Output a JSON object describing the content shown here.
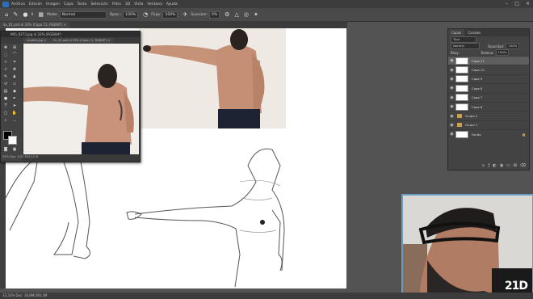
{
  "menu": {
    "items": [
      "Archivo",
      "Edición",
      "Imagen",
      "Capa",
      "Texto",
      "Selección",
      "Filtro",
      "3D",
      "Vista",
      "Ventana",
      "Ayuda"
    ]
  },
  "options": {
    "mode_label": "Modo:",
    "mode_value": "Normal",
    "opacity_label": "Opac.:",
    "opacity_value": "100%",
    "flow_label": "Flujo:",
    "flow_value": "100%",
    "smoothing_label": "Suavizar:",
    "smoothing_value": "0%",
    "brush_size": "9"
  },
  "doc_tabs": {
    "main_tab": "ilu_01.psd al 33% (Capa 11, RGB/8*) ×"
  },
  "reference_window": {
    "title": "IMG_9273.jpg al 33% (RGB/8#)",
    "tab1": "modelo.jpg ×",
    "tab2": "ilu_01.psd al 33% (Capa 11, RGB/8*) ×",
    "status": "33%     Doc: 3,22 M/3,22 M"
  },
  "layers_panel": {
    "tab_layers": "Capas",
    "tab_channels": "Canales",
    "kind_label": "Tipo",
    "blend_mode": "Normal",
    "opacity_label": "Opacidad:",
    "opacity_value": "100%",
    "lock_label": "Bloq.:",
    "fill_label": "Relleno:",
    "fill_value": "100%",
    "layers": [
      {
        "name": "Capa 11",
        "type": "layer",
        "selected": true
      },
      {
        "name": "Capa 10",
        "type": "layer",
        "selected": false
      },
      {
        "name": "Capa 9",
        "type": "layer",
        "selected": false
      },
      {
        "name": "Capa 8",
        "type": "layer",
        "selected": false
      },
      {
        "name": "Capa 7",
        "type": "layer",
        "selected": false
      },
      {
        "name": "Capa 6",
        "type": "layer",
        "selected": false
      },
      {
        "name": "Grupo 2",
        "type": "group",
        "selected": false
      },
      {
        "name": "Grupo 1",
        "type": "group",
        "selected": false
      },
      {
        "name": "Fondo",
        "type": "background",
        "selected": false
      }
    ]
  },
  "status_bar": {
    "text": "33,33%     Doc: 18,8M/280,3M"
  },
  "webcam": {
    "logo": "21D"
  },
  "icons": {
    "brush": "brush-icon",
    "eye": "eye-icon",
    "lock": "lock-icon",
    "folder": "folder-icon"
  },
  "colors": {
    "ui_dark": "#3c3c3c",
    "ui_panel": "#434343",
    "canvas": "#ffffff",
    "webcam_border": "#6b9dc0"
  }
}
